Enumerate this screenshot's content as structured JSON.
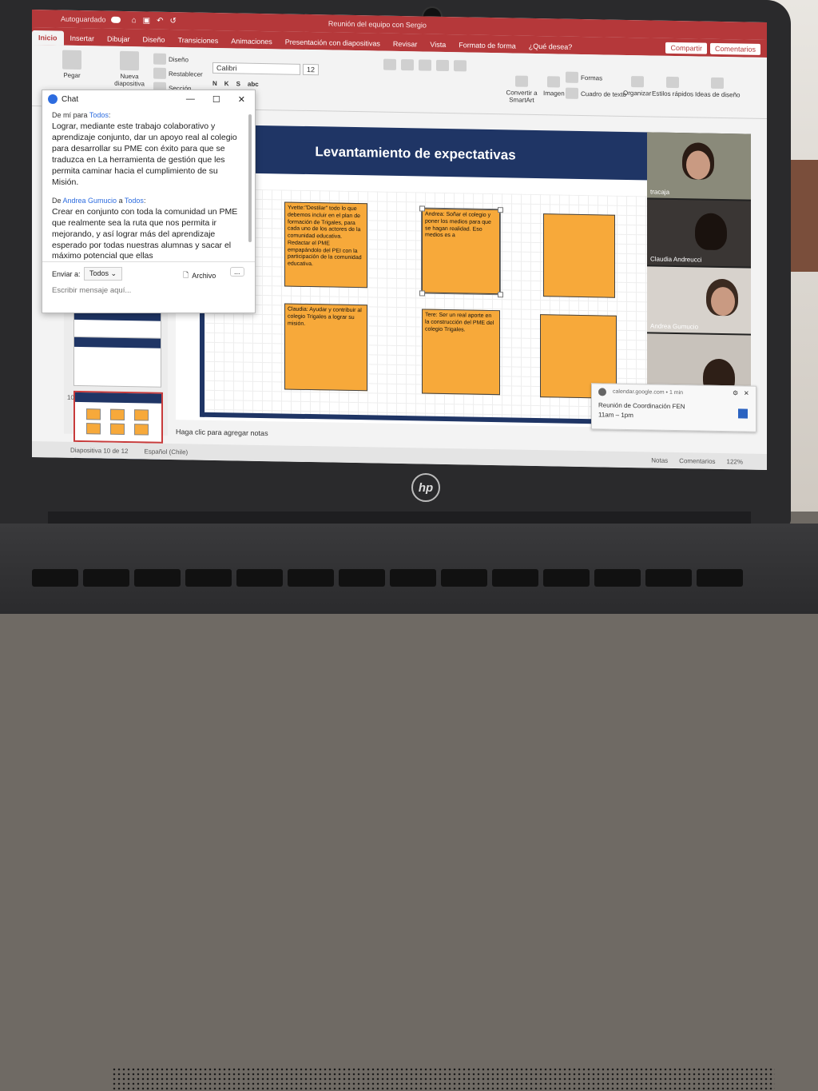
{
  "titlebar": {
    "autosave": "Autoguardado",
    "doc_title": "Reunión del equipo con Sergio"
  },
  "ribbon": {
    "tabs": [
      "Inicio",
      "Insertar",
      "Dibujar",
      "Diseño",
      "Transiciones",
      "Animaciones",
      "Presentación con diapositivas",
      "Revisar",
      "Vista",
      "Formato de forma",
      "¿Qué desea?"
    ],
    "share": "Compartir",
    "comments": "Comentarios",
    "paste": "Pegar",
    "new_slide": "Nueva diapositiva",
    "layout": "Diseño",
    "reset": "Restablecer",
    "section": "Sección",
    "font": "Calibri",
    "font_size": "12",
    "convert_smartart": "Convertir a SmartArt",
    "image": "Imagen",
    "forms": "Formas",
    "textbox": "Cuadro de texto",
    "organize": "Organizar",
    "quick_styles": "Estilos rápidos",
    "design_ideas": "Ideas de diseño"
  },
  "slides": {
    "numbers": [
      "10",
      "11"
    ],
    "thumb_title": "Levantamiento de expectativas"
  },
  "slide": {
    "title": "Levantamiento de expectativas",
    "notes_hint": "Haga clic para agregar notas",
    "stickies": [
      "Yvette:\"Destilar\" todo lo que debemos incluir en el plan de formación de Trigales, para cada uno de los actores de la comunidad educativa. Redactar el PME empapándolo del PEI con la participación de la comunidad educativa.",
      "Andrea: Soñar el colegio y poner los medios para que se hagan realidad. Eso medios es a",
      "",
      "Claudia: Ayudar y contribuir al colegio Trigales a lograr su misión.",
      "Tere: Ser un real aporte en la construcción del PME del colegio Trigales.",
      ""
    ]
  },
  "status": {
    "slide_count": "Diapositiva 10 de 12",
    "language": "Español (Chile)",
    "notes": "Notas",
    "comments": "Comentarios",
    "zoom": "122%"
  },
  "participants": [
    {
      "name": "tracaja"
    },
    {
      "name": "Claudia Andreucci"
    },
    {
      "name": "Andrea Gumucio"
    },
    {
      "name": ""
    }
  ],
  "notification": {
    "source": "calendar.google.com • 1 min",
    "title": "Reunión de Coordinación FEN",
    "time": "11am – 1pm"
  },
  "chat": {
    "title": "Chat",
    "messages": [
      {
        "from_prefix": "De mí para ",
        "from_name": "",
        "to_prefix": "",
        "to": "Todos",
        "suffix": ":",
        "text": "Lograr, mediante este trabajo colaborativo y aprendizaje conjunto, dar un apoyo real al colegio para desarrollar su PME con éxito para que se traduzca en La herramienta de gestión que les permita caminar hacia el cumplimiento de su Misión."
      },
      {
        "from_prefix": "De ",
        "from_name": "Andrea Gumucio",
        "to_prefix": " a ",
        "to": "Todos",
        "suffix": ":",
        "text": "Crear en conjunto con toda la comunidad un PME que realmente sea la ruta que nos permita ir mejorando, y así lograr más del aprendizaje esperado por todas nuestras alumnas y sacar el máximo potencial que ellas"
      }
    ],
    "send_to_label": "Enviar a:",
    "send_to_value": "Todos",
    "file_label": "Archivo",
    "more_label": "...",
    "input_placeholder": "Escribir mensaje aquí..."
  }
}
